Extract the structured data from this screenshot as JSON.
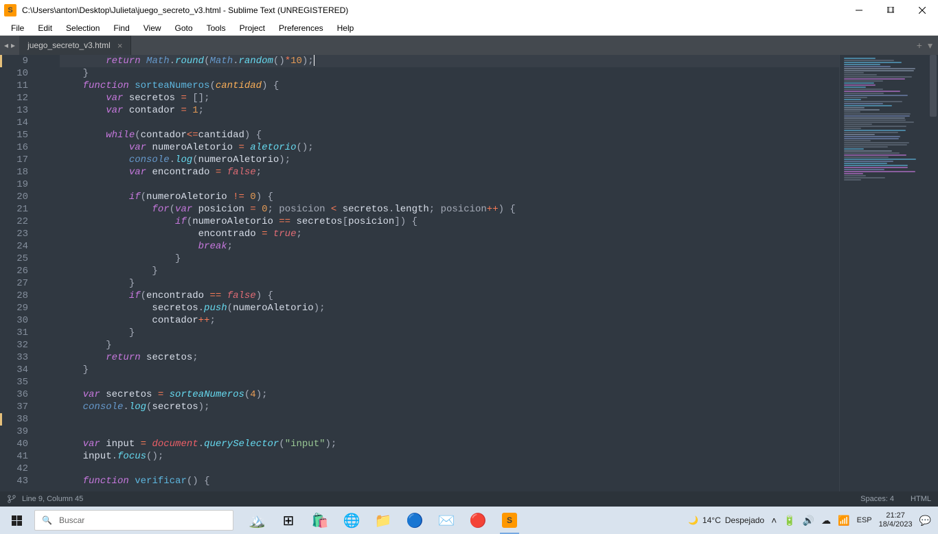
{
  "title": "C:\\Users\\anton\\Desktop\\Julieta\\juego_secreto_v3.html - Sublime Text (UNREGISTERED)",
  "menu": [
    "File",
    "Edit",
    "Selection",
    "Find",
    "View",
    "Goto",
    "Tools",
    "Project",
    "Preferences",
    "Help"
  ],
  "tab": {
    "name": "juego_secreto_v3.html"
  },
  "lines": [
    {
      "n": 9,
      "mod": true,
      "tokens": [
        [
          "        ",
          ""
        ],
        [
          "return",
          "kw"
        ],
        [
          " ",
          ""
        ],
        [
          "Math",
          "obj"
        ],
        [
          ".",
          "punc"
        ],
        [
          "round",
          "fncallit"
        ],
        [
          "(",
          "punc"
        ],
        [
          "Math",
          "obj"
        ],
        [
          ".",
          "punc"
        ],
        [
          "random",
          "fncallit"
        ],
        [
          "()",
          "punc"
        ],
        [
          "*",
          "op"
        ],
        [
          "10",
          "num"
        ],
        [
          ")",
          "punc"
        ],
        [
          ";",
          "punc"
        ]
      ],
      "hl": true,
      "cursor": true
    },
    {
      "n": 10,
      "tokens": [
        [
          "    }",
          "punc"
        ]
      ]
    },
    {
      "n": 11,
      "tokens": [
        [
          "    ",
          ""
        ],
        [
          "function",
          "stor"
        ],
        [
          " ",
          ""
        ],
        [
          "sorteaNumeros",
          "fn"
        ],
        [
          "(",
          "punc"
        ],
        [
          "cantidad",
          "param"
        ],
        [
          ")",
          "punc"
        ],
        [
          " {",
          "punc"
        ]
      ]
    },
    {
      "n": 12,
      "tokens": [
        [
          "        ",
          ""
        ],
        [
          "var",
          "stor"
        ],
        [
          " secretos ",
          "ident"
        ],
        [
          "=",
          "op"
        ],
        [
          " [];",
          "punc"
        ]
      ]
    },
    {
      "n": 13,
      "tokens": [
        [
          "        ",
          ""
        ],
        [
          "var",
          "stor"
        ],
        [
          " contador ",
          "ident"
        ],
        [
          "=",
          "op"
        ],
        [
          " ",
          ""
        ],
        [
          "1",
          "num"
        ],
        [
          ";",
          "punc"
        ]
      ]
    },
    {
      "n": 14,
      "tokens": [
        [
          "",
          ""
        ]
      ]
    },
    {
      "n": 15,
      "tokens": [
        [
          "        ",
          ""
        ],
        [
          "while",
          "kw"
        ],
        [
          "(",
          "punc"
        ],
        [
          "contador",
          "ident"
        ],
        [
          "<=",
          "op"
        ],
        [
          "cantidad",
          "ident"
        ],
        [
          ")",
          "punc"
        ],
        [
          " {",
          "punc"
        ]
      ]
    },
    {
      "n": 16,
      "tokens": [
        [
          "            ",
          ""
        ],
        [
          "var",
          "stor"
        ],
        [
          " numeroAletorio ",
          "ident"
        ],
        [
          "=",
          "op"
        ],
        [
          " ",
          ""
        ],
        [
          "aletorio",
          "fncallit"
        ],
        [
          "();",
          "punc"
        ]
      ]
    },
    {
      "n": 17,
      "tokens": [
        [
          "            ",
          ""
        ],
        [
          "console",
          "obj"
        ],
        [
          ".",
          "punc"
        ],
        [
          "log",
          "fncallit"
        ],
        [
          "(",
          "punc"
        ],
        [
          "numeroAletorio",
          "ident"
        ],
        [
          ");",
          "punc"
        ]
      ]
    },
    {
      "n": 18,
      "tokens": [
        [
          "            ",
          ""
        ],
        [
          "var",
          "stor"
        ],
        [
          " encontrado ",
          "ident"
        ],
        [
          "=",
          "op"
        ],
        [
          " ",
          ""
        ],
        [
          "false",
          "bool"
        ],
        [
          ";",
          "punc"
        ]
      ]
    },
    {
      "n": 19,
      "tokens": [
        [
          "",
          ""
        ]
      ]
    },
    {
      "n": 20,
      "tokens": [
        [
          "            ",
          ""
        ],
        [
          "if",
          "kw"
        ],
        [
          "(",
          "punc"
        ],
        [
          "numeroAletorio ",
          "ident"
        ],
        [
          "!=",
          "op"
        ],
        [
          " ",
          ""
        ],
        [
          "0",
          "num"
        ],
        [
          ")",
          "punc"
        ],
        [
          " {",
          "punc"
        ]
      ]
    },
    {
      "n": 21,
      "tokens": [
        [
          "                ",
          ""
        ],
        [
          "for",
          "kw"
        ],
        [
          "(",
          "punc"
        ],
        [
          "var",
          "stor"
        ],
        [
          " posicion ",
          "ident"
        ],
        [
          "=",
          "op"
        ],
        [
          " ",
          ""
        ],
        [
          "0",
          "num"
        ],
        [
          "; posicion ",
          "punc"
        ],
        [
          "<",
          "op"
        ],
        [
          " secretos",
          "ident"
        ],
        [
          ".",
          "punc"
        ],
        [
          "length",
          "ident"
        ],
        [
          "; posicion",
          "punc"
        ],
        [
          "++",
          "op"
        ],
        [
          ")",
          "punc"
        ],
        [
          " {",
          "punc"
        ]
      ]
    },
    {
      "n": 22,
      "tokens": [
        [
          "                    ",
          ""
        ],
        [
          "if",
          "kw"
        ],
        [
          "(",
          "punc"
        ],
        [
          "numeroAletorio ",
          "ident"
        ],
        [
          "==",
          "op"
        ],
        [
          " secretos",
          "ident"
        ],
        [
          "[",
          "punc"
        ],
        [
          "posicion",
          "ident"
        ],
        [
          "])",
          "punc"
        ],
        [
          " {",
          "punc"
        ]
      ]
    },
    {
      "n": 23,
      "tokens": [
        [
          "                        encontrado ",
          "ident"
        ],
        [
          "=",
          "op"
        ],
        [
          " ",
          ""
        ],
        [
          "true",
          "bool"
        ],
        [
          ";",
          "punc"
        ]
      ]
    },
    {
      "n": 24,
      "tokens": [
        [
          "                        ",
          ""
        ],
        [
          "break",
          "kw"
        ],
        [
          ";",
          "punc"
        ]
      ]
    },
    {
      "n": 25,
      "tokens": [
        [
          "                    }",
          "punc"
        ]
      ]
    },
    {
      "n": 26,
      "tokens": [
        [
          "                }",
          "punc"
        ]
      ]
    },
    {
      "n": 27,
      "tokens": [
        [
          "            }",
          "punc"
        ]
      ]
    },
    {
      "n": 28,
      "tokens": [
        [
          "            ",
          ""
        ],
        [
          "if",
          "kw"
        ],
        [
          "(",
          "punc"
        ],
        [
          "encontrado ",
          "ident"
        ],
        [
          "==",
          "op"
        ],
        [
          " ",
          ""
        ],
        [
          "false",
          "bool"
        ],
        [
          ")",
          "punc"
        ],
        [
          " {",
          "punc"
        ]
      ]
    },
    {
      "n": 29,
      "tokens": [
        [
          "                secretos",
          "ident"
        ],
        [
          ".",
          "punc"
        ],
        [
          "push",
          "fncallit"
        ],
        [
          "(",
          "punc"
        ],
        [
          "numeroAletorio",
          "ident"
        ],
        [
          ");",
          "punc"
        ]
      ]
    },
    {
      "n": 30,
      "tokens": [
        [
          "                contador",
          "ident"
        ],
        [
          "++",
          "op"
        ],
        [
          ";",
          "punc"
        ]
      ]
    },
    {
      "n": 31,
      "tokens": [
        [
          "            }",
          "punc"
        ]
      ]
    },
    {
      "n": 32,
      "tokens": [
        [
          "        }",
          "punc"
        ]
      ]
    },
    {
      "n": 33,
      "tokens": [
        [
          "        ",
          ""
        ],
        [
          "return",
          "kw"
        ],
        [
          " secretos",
          "ident"
        ],
        [
          ";",
          "punc"
        ]
      ]
    },
    {
      "n": 34,
      "tokens": [
        [
          "    }",
          "punc"
        ]
      ]
    },
    {
      "n": 35,
      "tokens": [
        [
          "",
          ""
        ]
      ]
    },
    {
      "n": 36,
      "tokens": [
        [
          "    ",
          ""
        ],
        [
          "var",
          "stor"
        ],
        [
          " secretos ",
          "ident"
        ],
        [
          "=",
          "op"
        ],
        [
          " ",
          ""
        ],
        [
          "sorteaNumeros",
          "fncallit"
        ],
        [
          "(",
          "punc"
        ],
        [
          "4",
          "num"
        ],
        [
          ");",
          "punc"
        ]
      ]
    },
    {
      "n": 37,
      "tokens": [
        [
          "    ",
          ""
        ],
        [
          "console",
          "obj"
        ],
        [
          ".",
          "punc"
        ],
        [
          "log",
          "fncallit"
        ],
        [
          "(",
          "punc"
        ],
        [
          "secretos",
          "ident"
        ],
        [
          ");",
          "punc"
        ]
      ]
    },
    {
      "n": 38,
      "mod": true,
      "tokens": [
        [
          "",
          ""
        ]
      ]
    },
    {
      "n": 39,
      "tokens": [
        [
          "",
          ""
        ]
      ]
    },
    {
      "n": 40,
      "tokens": [
        [
          "    ",
          ""
        ],
        [
          "var",
          "stor"
        ],
        [
          " input ",
          "ident"
        ],
        [
          "=",
          "op"
        ],
        [
          " ",
          ""
        ],
        [
          "document",
          "global"
        ],
        [
          ".",
          "punc"
        ],
        [
          "querySelector",
          "fncallit"
        ],
        [
          "(",
          "punc"
        ],
        [
          "\"input\"",
          "str"
        ],
        [
          ");",
          "punc"
        ]
      ]
    },
    {
      "n": 41,
      "tokens": [
        [
          "    input",
          "ident"
        ],
        [
          ".",
          "punc"
        ],
        [
          "focus",
          "fncallit"
        ],
        [
          "();",
          "punc"
        ]
      ]
    },
    {
      "n": 42,
      "tokens": [
        [
          "",
          ""
        ]
      ]
    },
    {
      "n": 43,
      "tokens": [
        [
          "    ",
          ""
        ],
        [
          "function",
          "stor"
        ],
        [
          " ",
          ""
        ],
        [
          "verificar",
          "fn"
        ],
        [
          "()",
          "punc"
        ],
        [
          " {",
          "punc"
        ]
      ]
    }
  ],
  "status": {
    "left": "Line 9, Column 45",
    "spaces": "Spaces: 4",
    "syntax": "HTML"
  },
  "taskbar": {
    "search_placeholder": "Buscar",
    "weather_temp": "14°C",
    "weather_desc": "Despejado",
    "lang": "ESP",
    "time": "21:27",
    "date": "18/4/2023"
  }
}
